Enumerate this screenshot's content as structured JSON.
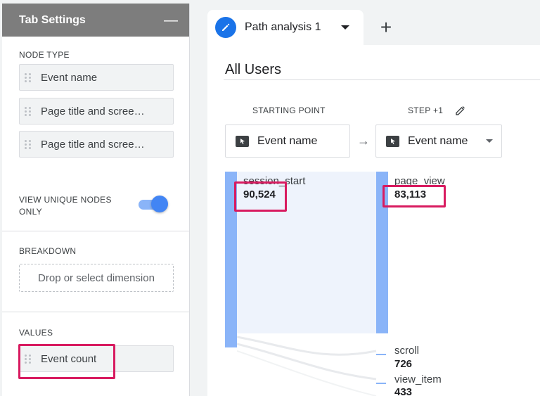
{
  "left_panel": {
    "title": "Tab Settings",
    "minimize_icon": "minimize-icon",
    "node_type": {
      "title": "NODE TYPE",
      "items": [
        "Event name",
        "Page title and scree…",
        "Page title and scree…"
      ]
    },
    "unique_nodes": {
      "label_line1": "VIEW UNIQUE NODES",
      "label_line2": "ONLY",
      "enabled": true
    },
    "breakdown": {
      "title": "BREAKDOWN",
      "placeholder": "Drop or select dimension"
    },
    "values": {
      "title": "VALUES",
      "item": "Event count"
    }
  },
  "tabs": {
    "active": "Path analysis 1",
    "add_label": "+"
  },
  "segment": "All Users",
  "columns": {
    "starting": {
      "header": "STARTING POINT",
      "selector": "Event name"
    },
    "step1": {
      "header": "STEP +1",
      "selector": "Event name"
    }
  },
  "nodes": {
    "start": {
      "name": "session_start",
      "value": "90,524"
    },
    "step1_main": {
      "name": "page_view",
      "value": "83,113"
    },
    "step1_scroll": {
      "name": "scroll",
      "value": "726"
    },
    "step1_view_item": {
      "name": "view_item",
      "value": "433"
    }
  },
  "colors": {
    "node_bar": "#8ab4f8",
    "highlight": "#d81b60",
    "accent": "#1a73e8"
  }
}
